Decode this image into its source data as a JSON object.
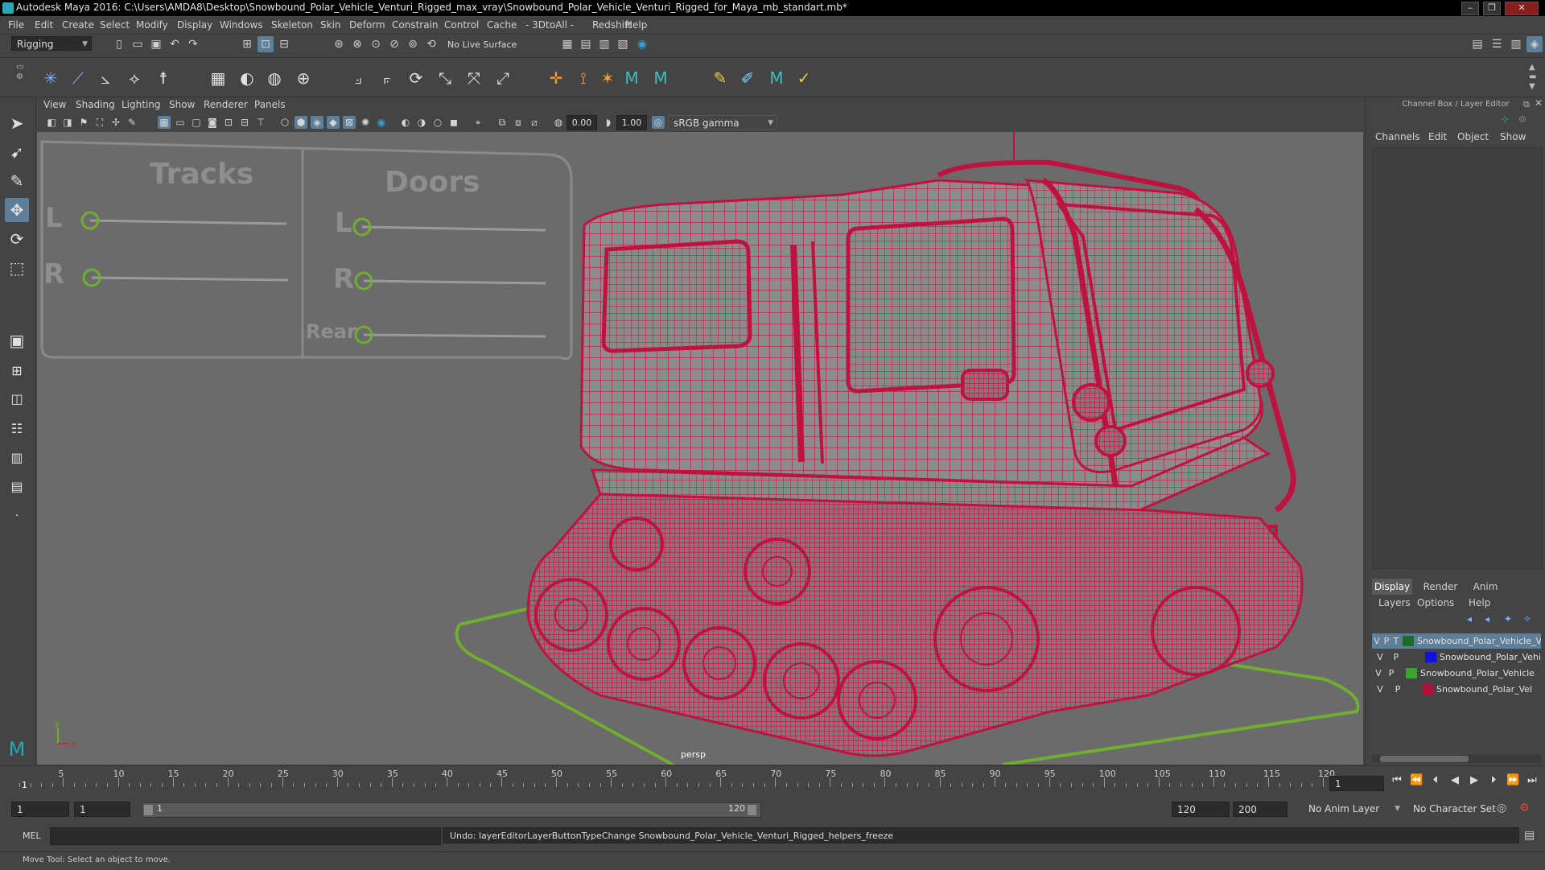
{
  "window": {
    "title": "Autodesk Maya 2016: C:\\Users\\AMDA8\\Desktop\\Snowbound_Polar_Vehicle_Venturi_Rigged_max_vray\\Snowbound_Polar_Vehicle_Venturi_Rigged_for_Maya_mb_standart.mb*",
    "minimize": "–",
    "maximize": "❐",
    "close": "✕"
  },
  "menu": [
    "File",
    "Edit",
    "Create",
    "Select",
    "Modify",
    "Display",
    "Windows",
    "Skeleton",
    "Skin",
    "Deform",
    "Constrain",
    "Control",
    "Cache",
    "- 3DtoAll -",
    "Redshift",
    "Help"
  ],
  "statusline": {
    "mode": "Rigging",
    "live_surface": "No Live Surface"
  },
  "panel_menu": [
    "View",
    "Shading",
    "Lighting",
    "Show",
    "Renderer",
    "Panels"
  ],
  "panel_bar": {
    "exposure": "0.00",
    "gamma": "1.00",
    "color_space": "sRGB gamma"
  },
  "viewport": {
    "camera": "persp",
    "axis_y": "y",
    "axis_x": "x",
    "controls": {
      "tracks_title": "Tracks",
      "doors_title": "Doors",
      "tracks_l": "L",
      "tracks_r": "R",
      "doors_l": "L",
      "doors_r": "R",
      "doors_rear": "Rear"
    },
    "colors": {
      "background": "#6b6b6b",
      "wire": "#c0123f",
      "mesh": "#8a8a8a",
      "controller": "#6fae2e"
    }
  },
  "channel_box": {
    "header": "Channel Box / Layer Editor",
    "menu": [
      "Channels",
      "Edit",
      "Object",
      "Show"
    ],
    "tabs": [
      "Display",
      "Render",
      "Anim"
    ],
    "layer_menu": [
      "Layers",
      "Options",
      "Help"
    ],
    "layers": [
      {
        "v": "V",
        "p": "P",
        "t": "T",
        "color": "#1d6b2a",
        "name": "Snowbound_Polar_Vehicle_V",
        "selected": true
      },
      {
        "v": "V",
        "p": "P",
        "t": "",
        "color": "#1010e0",
        "name": "Snowbound_Polar_Vehi",
        "selected": false
      },
      {
        "v": "V",
        "p": "P",
        "t": "",
        "color": "#3aa52a",
        "name": "Snowbound_Polar_Vehicle",
        "selected": false
      },
      {
        "v": "V",
        "p": "P",
        "t": "",
        "color": "#b0103a",
        "name": "Snowbound_Polar_Vel",
        "selected": false
      }
    ]
  },
  "timeline": {
    "ticks": [
      5,
      10,
      15,
      20,
      25,
      30,
      35,
      40,
      45,
      50,
      55,
      60,
      65,
      70,
      75,
      80,
      85,
      90,
      95,
      100,
      105,
      110,
      115,
      120
    ],
    "start_marker": "1",
    "current_frame": "1"
  },
  "range": {
    "start": "1",
    "range_start": "1",
    "slider_start": "1",
    "slider_end": "120",
    "range_end": "120",
    "end": "200",
    "anim_layer": "No Anim Layer",
    "char_set": "No Character Set"
  },
  "command": {
    "lang": "MEL",
    "result": "Undo: layerEditorLayerButtonTypeChange Snowbound_Polar_Vehicle_Venturi_Rigged_helpers_freeze"
  },
  "help_line": "Move Tool: Select an object to move."
}
